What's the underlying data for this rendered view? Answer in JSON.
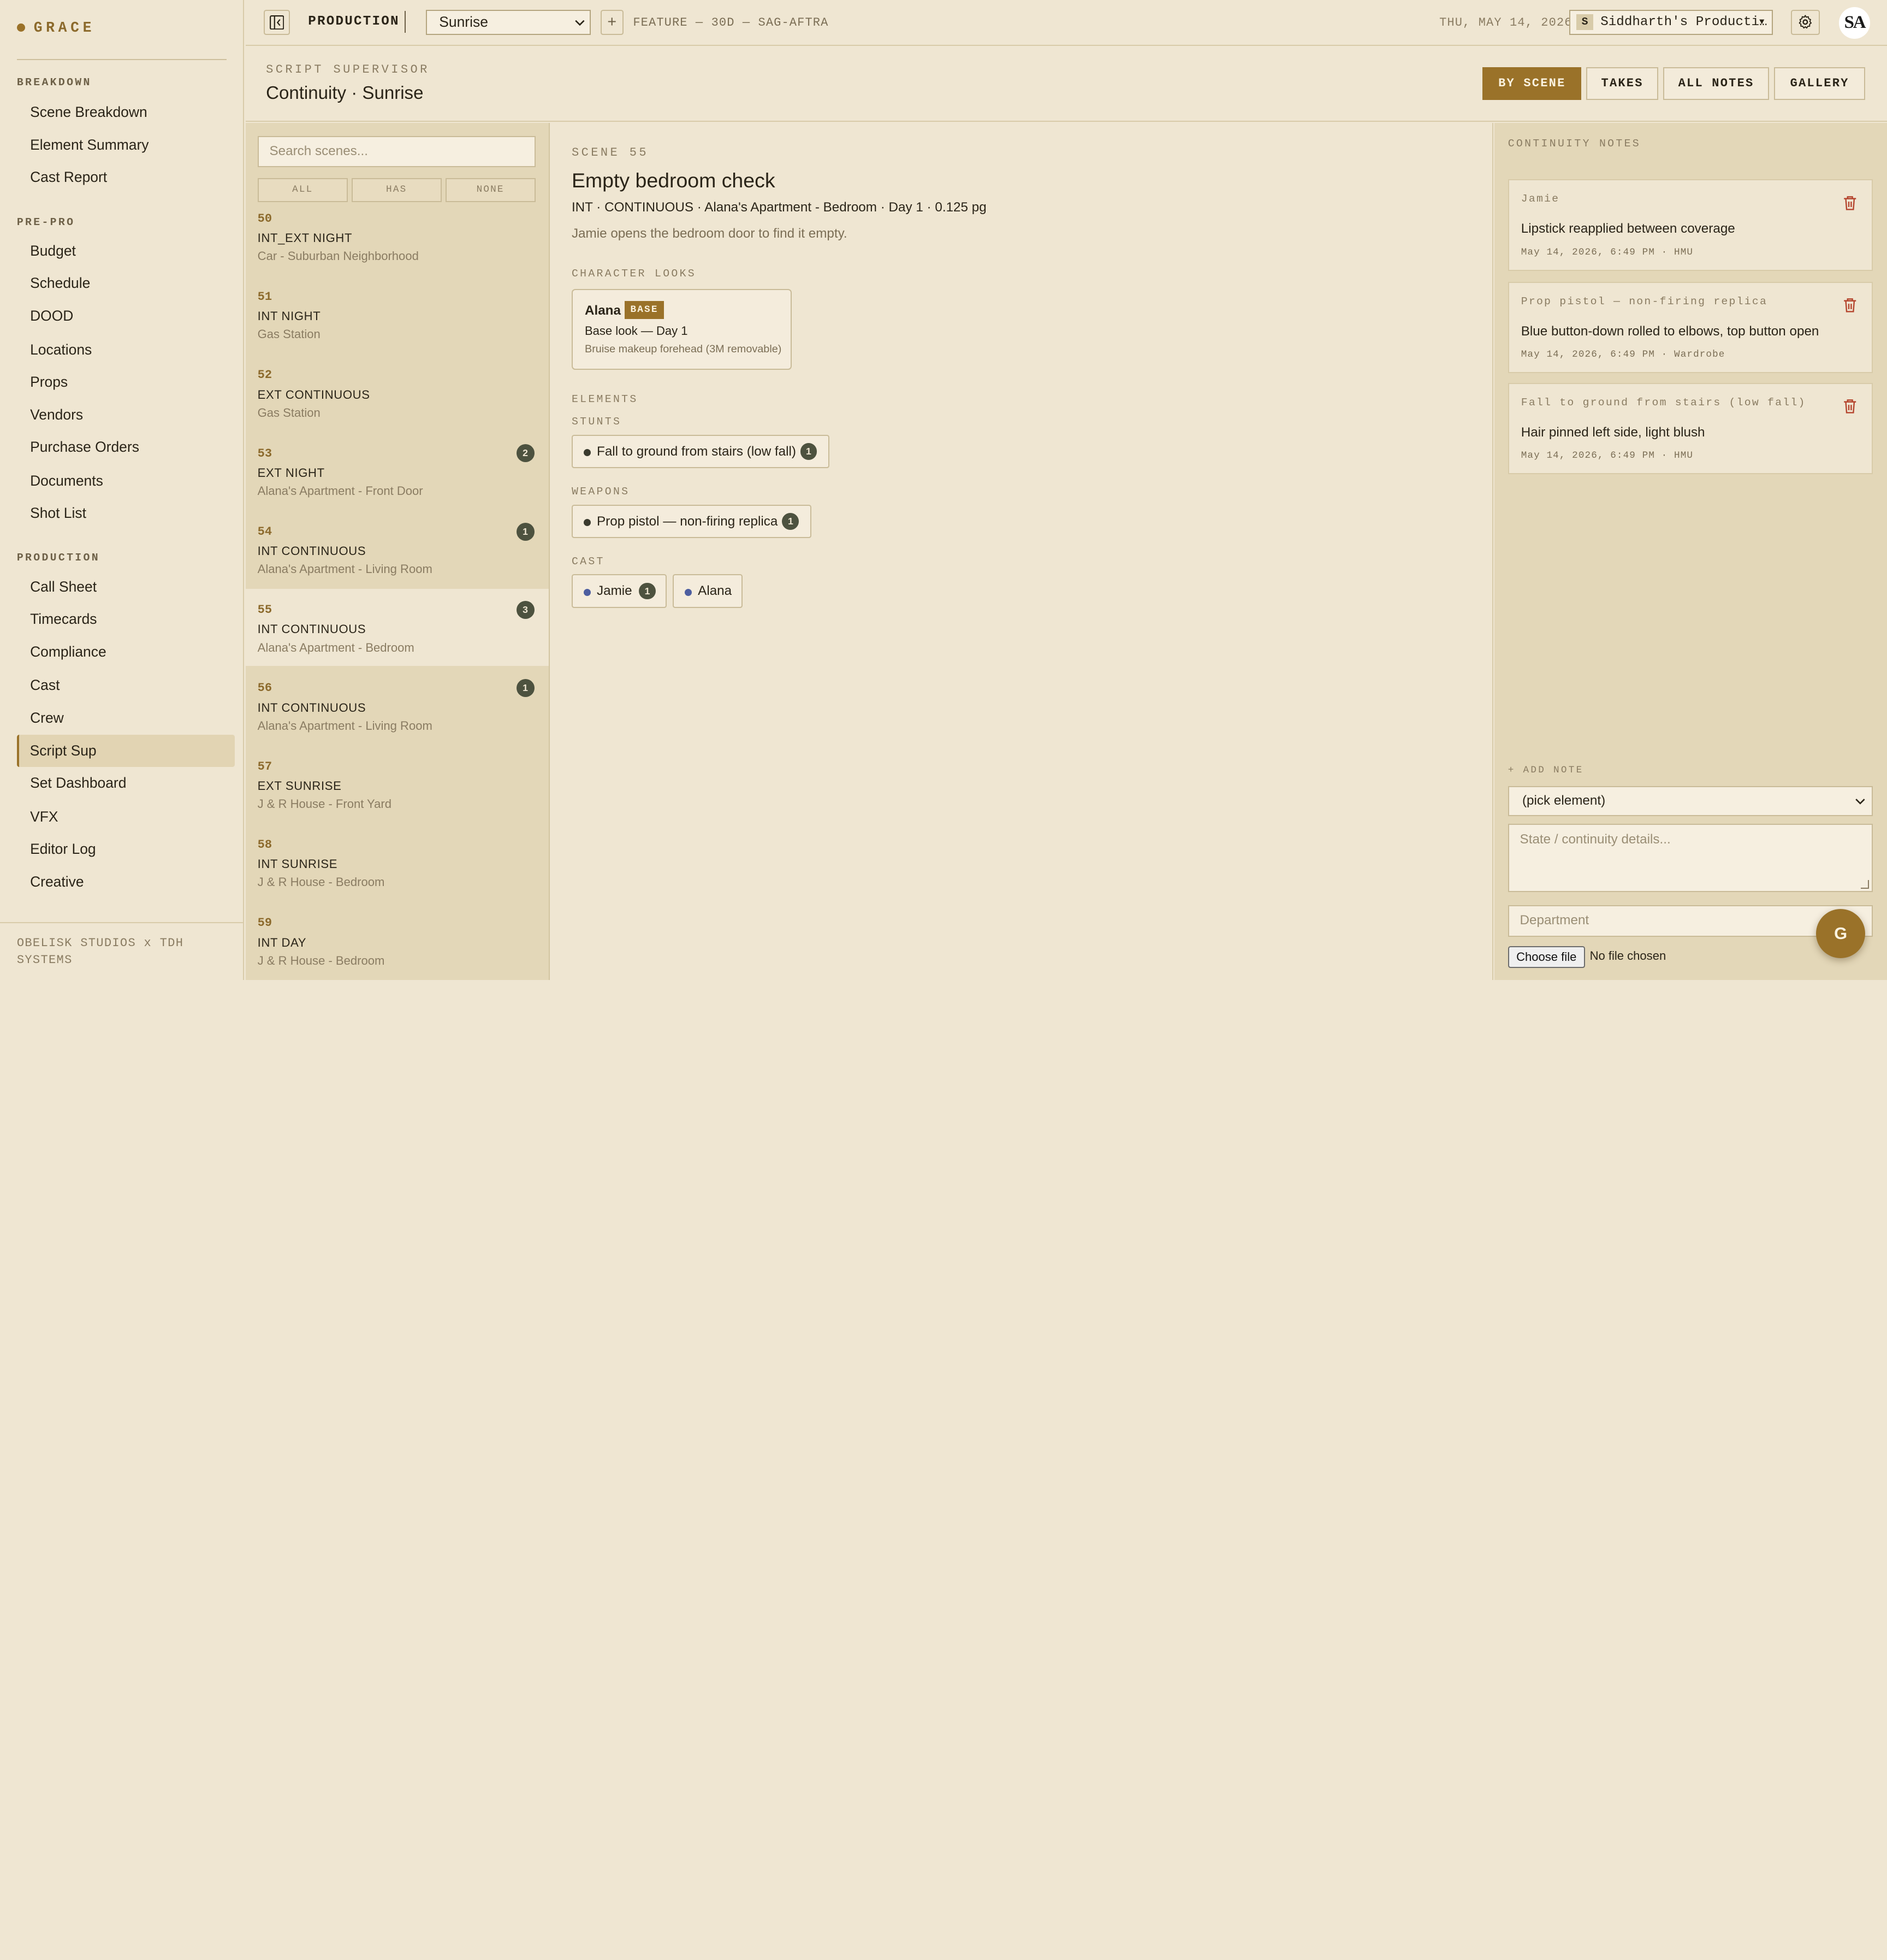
{
  "brand": {
    "name": "GRACE"
  },
  "sidebar": {
    "sections": [
      {
        "label": "BREAKDOWN",
        "items": [
          "Scene Breakdown",
          "Element Summary",
          "Cast Report"
        ]
      },
      {
        "label": "PRE-PRO",
        "items": [
          "Budget",
          "Schedule",
          "DOOD",
          "Locations",
          "Props",
          "Vendors",
          "Purchase Orders",
          "Documents",
          "Shot List"
        ]
      },
      {
        "label": "PRODUCTION",
        "items": [
          "Call Sheet",
          "Timecards",
          "Compliance",
          "Cast",
          "Crew",
          "Script Sup",
          "Set Dashboard",
          "VFX",
          "Editor Log",
          "Creative"
        ]
      }
    ],
    "active_item": "Script Sup",
    "footer": "OBELISK STUDIOS x TDH SYSTEMS"
  },
  "topbar": {
    "mode_label": "PRODUCTION",
    "project": "Sunrise",
    "add_symbol": "+",
    "meta": "FEATURE — 30D — SAG-AFTRA",
    "date": "THU, MAY 14, 2026",
    "org_initial": "S",
    "org_name": "Siddharth's Producti…",
    "org_caret": "▼",
    "avatar_initials": "SA"
  },
  "page": {
    "eyebrow": "SCRIPT SUPERVISOR",
    "title": "Continuity · Sunrise",
    "tabs": [
      "BY SCENE",
      "TAKES",
      "ALL NOTES",
      "GALLERY"
    ],
    "active_tab": "BY SCENE"
  },
  "scene_list": {
    "search_placeholder": "Search scenes...",
    "filters": [
      "ALL",
      "HAS",
      "NONE"
    ],
    "partial_num": "50",
    "partial": {
      "slug": "INT_EXT NIGHT",
      "location": "Car - Suburban Neighborhood"
    },
    "scenes": [
      {
        "num": "51",
        "slug": "INT NIGHT",
        "location": "Gas Station",
        "count": ""
      },
      {
        "num": "52",
        "slug": "EXT CONTINUOUS",
        "location": "Gas Station",
        "count": ""
      },
      {
        "num": "53",
        "slug": "EXT NIGHT",
        "location": "Alana's Apartment - Front Door",
        "count": "2"
      },
      {
        "num": "54",
        "slug": "INT CONTINUOUS",
        "location": "Alana's Apartment - Living Room",
        "count": "1"
      },
      {
        "num": "55",
        "slug": "INT CONTINUOUS",
        "location": "Alana's Apartment - Bedroom",
        "count": "3"
      },
      {
        "num": "56",
        "slug": "INT CONTINUOUS",
        "location": "Alana's Apartment - Living Room",
        "count": "1"
      },
      {
        "num": "57",
        "slug": "EXT SUNRISE",
        "location": "J & R House - Front Yard",
        "count": ""
      },
      {
        "num": "58",
        "slug": "INT SUNRISE",
        "location": "J & R House - Bedroom",
        "count": ""
      },
      {
        "num": "59",
        "slug": "INT DAY",
        "location": "J & R House - Bedroom",
        "count": ""
      }
    ],
    "active_scene": "55"
  },
  "detail": {
    "eyebrow": "SCENE 55",
    "title": "Empty bedroom check",
    "meta": "INT · CONTINUOUS · Alana's Apartment - Bedroom · Day 1 · 0.125 pg",
    "description": "Jamie opens the bedroom door to find it empty.",
    "looks_label": "CHARACTER LOOKS",
    "look": {
      "name": "Alana",
      "badge": "BASE",
      "description": "Base look — Day 1",
      "note": "Bruise makeup forehead (3M removable)"
    },
    "elements_label": "ELEMENTS",
    "stunts_label": "STUNTS",
    "stunt": {
      "label": "Fall to ground from stairs (low fall)",
      "count": "1"
    },
    "weapons_label": "WEAPONS",
    "weapon": {
      "label": "Prop pistol — non-firing replica",
      "count": "1"
    },
    "cast_label": "CAST",
    "cast": [
      {
        "label": "Jamie",
        "count": "1"
      },
      {
        "label": "Alana",
        "count": ""
      }
    ]
  },
  "notes": {
    "eyebrow": "CONTINUITY NOTES",
    "items": [
      {
        "tag": "Jamie",
        "text": "Lipstick reapplied between coverage",
        "meta": "May 14, 2026, 6:49 PM · HMU"
      },
      {
        "tag": "Prop pistol — non-firing replica",
        "text": "Blue button-down rolled to elbows, top button open",
        "meta": "May 14, 2026, 6:49 PM · Wardrobe"
      },
      {
        "tag": "Fall to ground from stairs (low fall)",
        "text": "Hair pinned left side, light blush",
        "meta": "May 14, 2026, 6:49 PM · HMU"
      }
    ],
    "add_label": "+ ADD NOTE",
    "element_select": "(pick element)",
    "details_placeholder": "State / continuity details...",
    "department_placeholder": "Department",
    "file_button": "Choose file",
    "file_status": "No file chosen"
  },
  "fab": {
    "label": "G"
  },
  "colors": {
    "accent": "#9a7229",
    "background": "#efe6d2",
    "panel": "#e3d7b8",
    "badge": "#4d523f"
  }
}
